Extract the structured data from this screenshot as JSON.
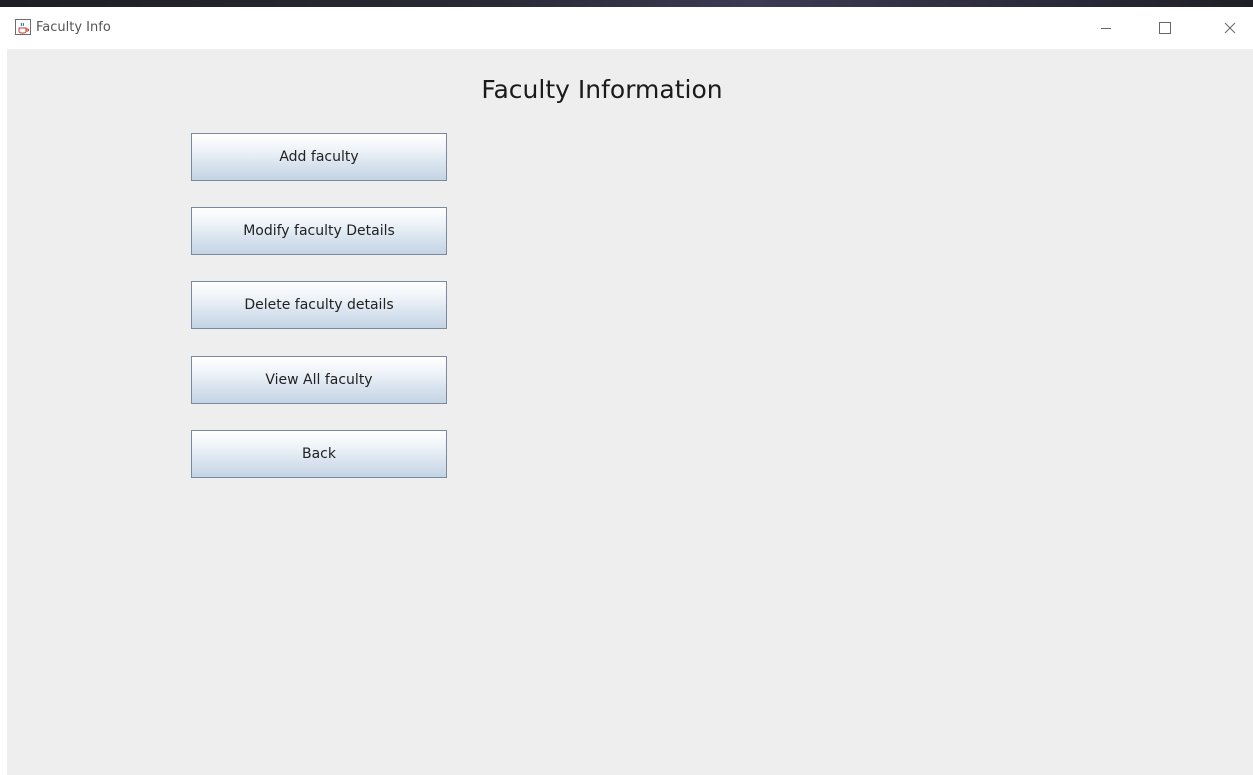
{
  "window": {
    "title": "Faculty Info",
    "app_icon": "java-cup-icon",
    "controls": {
      "minimize_icon": "minimize-icon",
      "maximize_icon": "maximize-icon",
      "close_icon": "close-icon"
    }
  },
  "main": {
    "heading": "Faculty Information",
    "buttons": [
      {
        "label": "Add faculty"
      },
      {
        "label": "Modify faculty Details"
      },
      {
        "label": "Delete faculty details"
      },
      {
        "label": "View All faculty"
      },
      {
        "label": "Back"
      }
    ]
  },
  "colors": {
    "content_background": "#eeeeee",
    "button_border": "#7a8a9c",
    "button_gradient_bottom": "#c4d4e4"
  }
}
